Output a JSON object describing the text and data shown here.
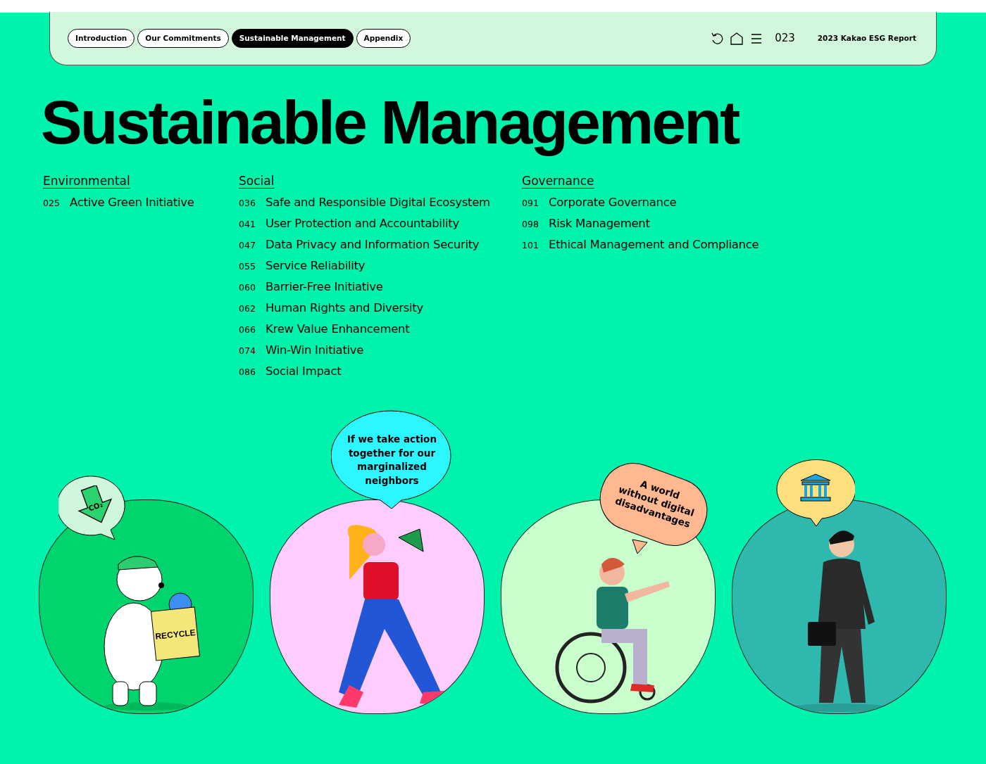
{
  "nav": {
    "tabs": [
      {
        "label": "Introduction",
        "selected": false
      },
      {
        "label": "Our Commitments",
        "selected": false
      },
      {
        "label": "Sustainable Management",
        "selected": true
      },
      {
        "label": "Appendix",
        "selected": false
      }
    ],
    "page": "023",
    "report_title": "2023 Kakao ESG Report"
  },
  "title": "Sustainable Management",
  "sections": [
    {
      "heading": "Environmental",
      "items": [
        {
          "page": "025",
          "label": "Active Green Initiative"
        }
      ]
    },
    {
      "heading": "Social",
      "items": [
        {
          "page": "036",
          "label": "Safe and Responsible Digital Ecosystem"
        },
        {
          "page": "041",
          "label": "User Protection and Accountability"
        },
        {
          "page": "047",
          "label": "Data Privacy and Information Security"
        },
        {
          "page": "055",
          "label": "Service Reliability"
        },
        {
          "page": "060",
          "label": "Barrier-Free Initiative"
        },
        {
          "page": "062",
          "label": "Human Rights and Diversity"
        },
        {
          "page": "066",
          "label": "Krew Value Enhancement"
        },
        {
          "page": "074",
          "label": "Win-Win Initiative"
        },
        {
          "page": "086",
          "label": "Social Impact"
        }
      ]
    },
    {
      "heading": "Governance",
      "items": [
        {
          "page": "091",
          "label": "Corporate Governance"
        },
        {
          "page": "098",
          "label": "Risk Management"
        },
        {
          "page": "101",
          "label": "Ethical Management and Compliance"
        }
      ]
    }
  ],
  "illustrations": [
    {
      "kind": "bear",
      "color": "#00d46c",
      "box_label": "RECYCLE",
      "bubble": {
        "kind": "co2",
        "color": "#cff7dc",
        "label": "CO₂"
      }
    },
    {
      "kind": "activist",
      "color": "#ffccff",
      "bubble": {
        "kind": "text",
        "color": "#2cf6ff",
        "text": "If we take action together for our marginalized neighbors"
      }
    },
    {
      "kind": "wheelchair",
      "color": "#c8ffcc",
      "bubble": {
        "kind": "tilted",
        "color": "#ffb88f",
        "text": "A world without digital disadvantages"
      }
    },
    {
      "kind": "businessman",
      "color": "#2fb8ae",
      "bubble": {
        "kind": "building",
        "color": "#ffe07f"
      }
    }
  ]
}
